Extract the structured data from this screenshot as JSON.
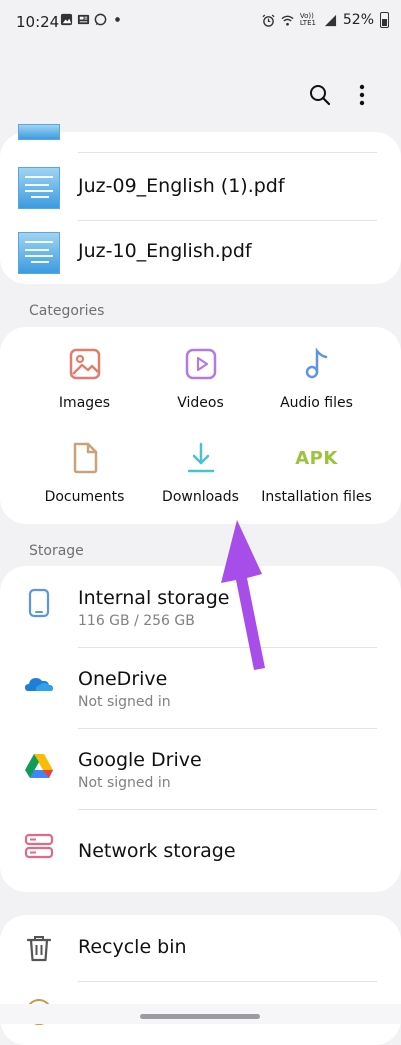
{
  "status": {
    "time": "10:24",
    "left_icons": [
      "image-icon",
      "news-icon",
      "whatsapp-icon",
      "dot-icon"
    ],
    "right_icons": [
      "alarm-icon",
      "wifi-icon",
      "volte-icon",
      "signal-icon"
    ],
    "volte_label": "Vo)) LTE1",
    "battery": "52%"
  },
  "appbar": {
    "icons": [
      "search-icon",
      "more-vertical-icon"
    ]
  },
  "recent_files": [
    {
      "name": "Juz-09_English (1).pdf"
    },
    {
      "name": "Juz-10_English.pdf"
    }
  ],
  "categories": {
    "label": "Categories",
    "items": [
      {
        "label": "Images",
        "icon": "image-icon",
        "color": "#e07d6e"
      },
      {
        "label": "Videos",
        "icon": "video-icon",
        "color": "#b37be0"
      },
      {
        "label": "Audio files",
        "icon": "music-note-icon",
        "color": "#5c95e6"
      },
      {
        "label": "Documents",
        "icon": "document-icon",
        "color": "#c9a27a"
      },
      {
        "label": "Downloads",
        "icon": "download-icon",
        "color": "#4bc1cf"
      },
      {
        "label": "Installation files",
        "icon": "apk-icon",
        "color": "#9bc43c",
        "icon_text": "APK"
      }
    ]
  },
  "storage": {
    "label": "Storage",
    "items": [
      {
        "title": "Internal storage",
        "subtitle": "116 GB / 256 GB",
        "icon": "phone-icon"
      },
      {
        "title": "OneDrive",
        "subtitle": "Not signed in",
        "icon": "onedrive-icon"
      },
      {
        "title": "Google Drive",
        "subtitle": "Not signed in",
        "icon": "google-drive-icon"
      },
      {
        "title": "Network storage",
        "subtitle": "",
        "icon": "network-storage-icon"
      }
    ]
  },
  "bottom": {
    "items": [
      {
        "title": "Recycle bin",
        "icon": "trash-icon"
      }
    ]
  },
  "annotation": {
    "color": "#a64dea",
    "icon": "arrow-pointer-icon"
  }
}
